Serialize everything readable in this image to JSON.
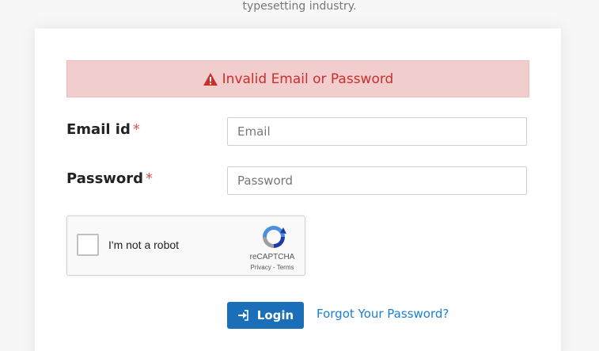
{
  "intro_text": "typesetting industry.",
  "alert": {
    "icon": "warning-icon",
    "message": "Invalid Email or Password",
    "color": "#c9302c",
    "background": "#f2cdcd"
  },
  "form": {
    "email": {
      "label": "Email id",
      "required_mark": "*",
      "placeholder": "Email",
      "value": ""
    },
    "password": {
      "label": "Password",
      "required_mark": "*",
      "placeholder": "Password",
      "value": ""
    }
  },
  "captcha": {
    "label": "I'm not a robot",
    "brand": "reCAPTCHA",
    "terms": "Privacy - Terms",
    "checked": false,
    "icon": "recaptcha-icon"
  },
  "actions": {
    "login_label": "Login",
    "login_icon": "sign-in-icon",
    "forgot_label": "Forgot Your Password?"
  },
  "colors": {
    "primary": "#1a6fb8",
    "link": "#1a7fd4",
    "required": "#d9534f"
  }
}
